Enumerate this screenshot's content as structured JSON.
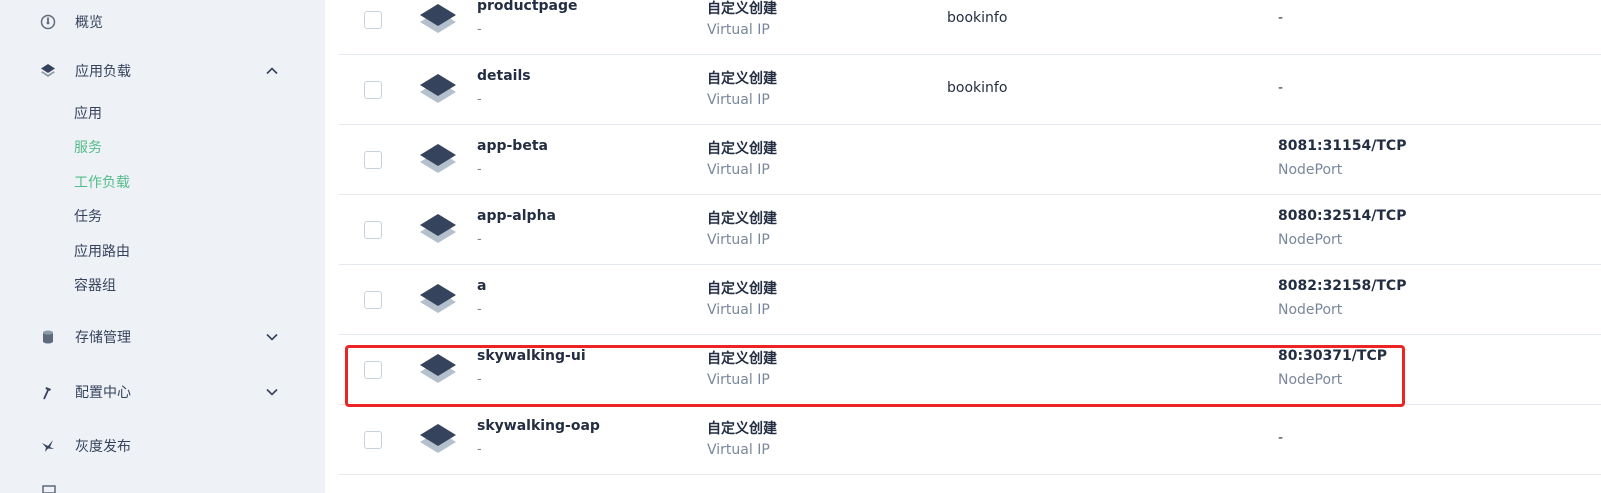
{
  "sidebar": {
    "overview": {
      "label": "概览",
      "icon": "dashboard-icon"
    },
    "workloads": {
      "label": "应用负载",
      "icon": "layers-icon",
      "expanded": true,
      "items": [
        {
          "label": "应用",
          "active": false
        },
        {
          "label": "服务",
          "active": true
        },
        {
          "label": "工作负载",
          "active": true
        },
        {
          "label": "任务",
          "active": false
        },
        {
          "label": "应用路由",
          "active": false
        },
        {
          "label": "容器组",
          "active": false
        }
      ]
    },
    "storage": {
      "label": "存储管理",
      "icon": "database-icon"
    },
    "config": {
      "label": "配置中心",
      "icon": "hammer-icon"
    },
    "canary": {
      "label": "灰度发布",
      "icon": "bird-icon"
    }
  },
  "services": [
    {
      "name": "productpage",
      "desc": "-",
      "create": "自定义创建",
      "type": "Virtual IP",
      "app": "bookinfo",
      "ports": "-",
      "port_type": ""
    },
    {
      "name": "details",
      "desc": "-",
      "create": "自定义创建",
      "type": "Virtual IP",
      "app": "bookinfo",
      "ports": "-",
      "port_type": ""
    },
    {
      "name": "app-beta",
      "desc": "-",
      "create": "自定义创建",
      "type": "Virtual IP",
      "app": "",
      "ports": "8081:31154/TCP",
      "port_type": "NodePort"
    },
    {
      "name": "app-alpha",
      "desc": "-",
      "create": "自定义创建",
      "type": "Virtual IP",
      "app": "",
      "ports": "8080:32514/TCP",
      "port_type": "NodePort"
    },
    {
      "name": "a",
      "desc": "-",
      "create": "自定义创建",
      "type": "Virtual IP",
      "app": "",
      "ports": "8082:32158/TCP",
      "port_type": "NodePort"
    },
    {
      "name": "skywalking-ui",
      "desc": "-",
      "create": "自定义创建",
      "type": "Virtual IP",
      "app": "",
      "ports": "80:30371/TCP",
      "port_type": "NodePort"
    },
    {
      "name": "skywalking-oap",
      "desc": "-",
      "create": "自定义创建",
      "type": "Virtual IP",
      "app": "",
      "ports": "-",
      "port_type": ""
    }
  ],
  "colors": {
    "accent": "#55bc8a",
    "highlight": "#ec2424",
    "icon_dark": "#36435c",
    "icon_light": "#b4c0cc"
  }
}
